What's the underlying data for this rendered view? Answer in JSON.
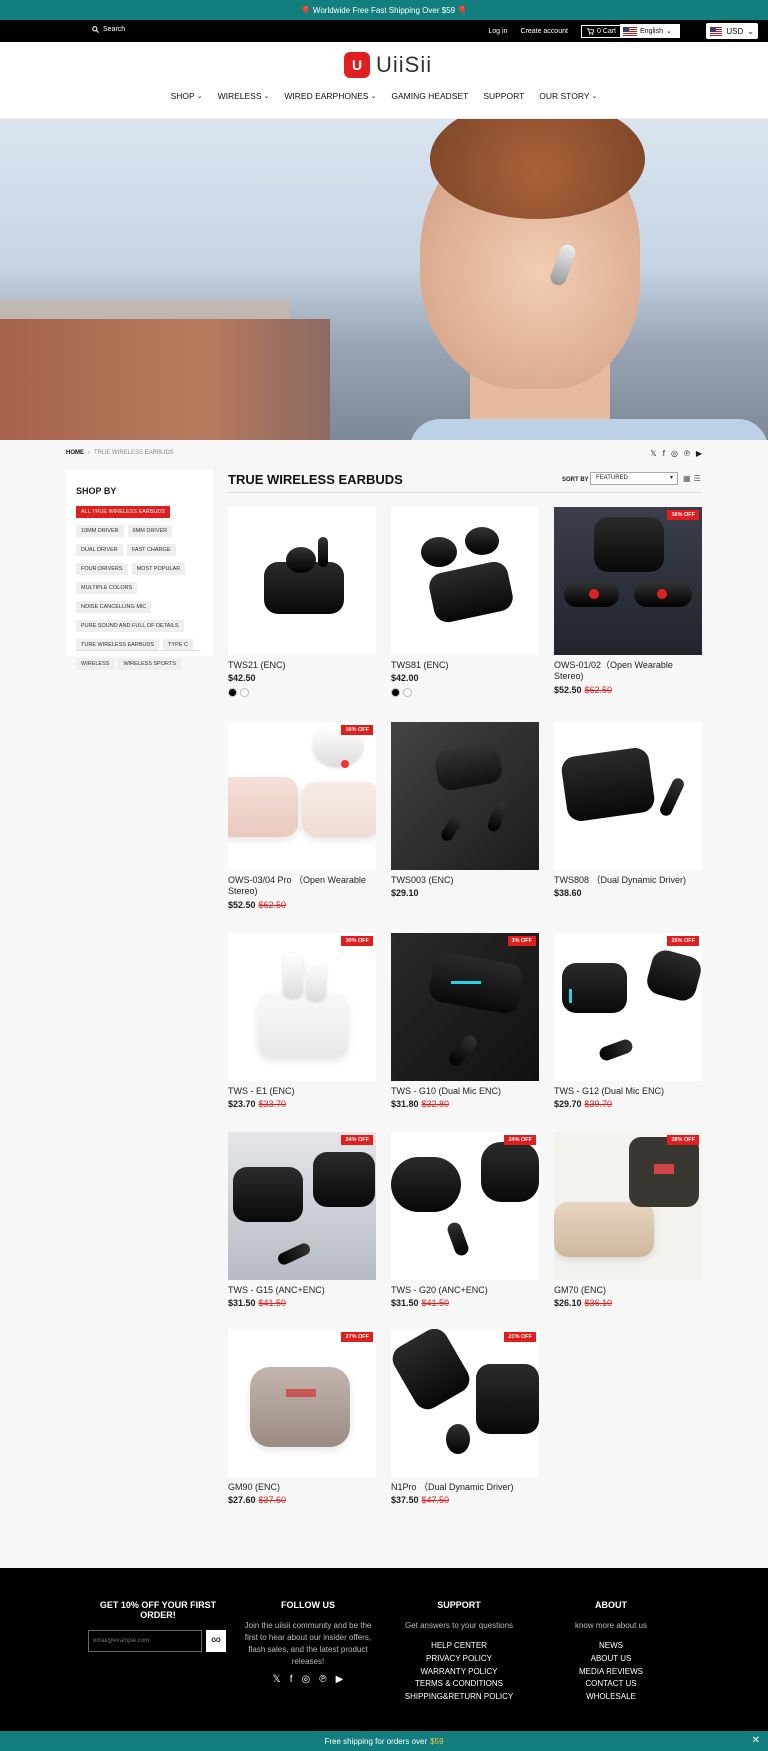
{
  "announce": {
    "text": "🎈 Worldwide Free Fast Shipping Over $59 🎈"
  },
  "topbar": {
    "search": "Search",
    "login": "Log in",
    "create_account": "Create account",
    "cart": "0 Cart",
    "language": "English",
    "currency": "USD"
  },
  "logo": {
    "mark": "U",
    "word": "UiiSii"
  },
  "nav": [
    "SHOP",
    "WIRELESS",
    "WIRED EARPHONES",
    "GAMING HEADSET",
    "SUPPORT",
    "OUR STORY"
  ],
  "nav_dropdown": [
    true,
    true,
    true,
    false,
    false,
    true
  ],
  "breadcrumb": {
    "home": "HOME",
    "sep": "›",
    "current": "TRUE WIRELESS EARBUDS"
  },
  "sidebar": {
    "title": "SHOP BY",
    "tags": [
      "ALL TRUE WIRELESS EARBUDS",
      "10MM DRIVER",
      "6MM DRIVER",
      "DUAL DRIVER",
      "FAST CHARGE",
      "FOUR DRIVERS",
      "MOST POPULAR",
      "MULTIPLE COLORS",
      "NOISE CANCELLING MIC",
      "PURE SOUND AND FULL OF DETAILS",
      "TURE WIRELESS EARBUDS",
      "TYPE C",
      "WIRELESS",
      "WIRELESS SPORTS"
    ]
  },
  "collection": {
    "title": "TRUE WIRELESS EARBUDS",
    "sort_label": "SORT BY",
    "sort_value": "FEATURED"
  },
  "products": [
    {
      "name": "TWS21 (ENC)",
      "price": "$42.50",
      "was": "",
      "badge": "",
      "swatches": true
    },
    {
      "name": "TWS81 (ENC)",
      "price": "$42.00",
      "was": "",
      "badge": "",
      "swatches": true
    },
    {
      "name": "OWS-01/02（Open Wearable Stereo)",
      "price": "$52.50",
      "was": "$62.50",
      "badge": "16% OFF"
    },
    {
      "name": "OWS-03/04 Pro （Open Wearable Stereo)",
      "price": "$52.50",
      "was": "$62.50",
      "badge": "16% OFF"
    },
    {
      "name": "TWS003 (ENC)",
      "price": "$29.10",
      "was": "",
      "badge": ""
    },
    {
      "name": "TWS808 （Dual Dynamic Driver)",
      "price": "$38.60",
      "was": "",
      "badge": ""
    },
    {
      "name": "TWS - E1 (ENC)",
      "price": "$23.70",
      "was": "$33.70",
      "badge": "30% OFF"
    },
    {
      "name": "TWS - G10 (Dual Mic ENC)",
      "price": "$31.80",
      "was": "$32.80",
      "badge": "3% OFF"
    },
    {
      "name": "TWS - G12 (Dual Mic ENC)",
      "price": "$29.70",
      "was": "$39.70",
      "badge": "25% OFF"
    },
    {
      "name": "TWS - G15 (ANC+ENC)",
      "price": "$31.50",
      "was": "$41.50",
      "badge": "24% OFF"
    },
    {
      "name": "TWS - G20 (ANC+ENC)",
      "price": "$31.50",
      "was": "$41.50",
      "badge": "24% OFF"
    },
    {
      "name": "GM70 (ENC)",
      "price": "$26.10",
      "was": "$36.10",
      "badge": "28% OFF"
    },
    {
      "name": "GM90 (ENC)",
      "price": "$27.60",
      "was": "$37.60",
      "badge": "27% OFF"
    },
    {
      "name": "N1Pro （Dual Dynamic Driver)",
      "price": "$37.50",
      "was": "$47.50",
      "badge": "21% OFF"
    }
  ],
  "footer": {
    "newsletter": {
      "title": "GET 10% OFF YOUR FIRST ORDER!",
      "placeholder": "email@example.com",
      "button": "GO"
    },
    "follow": {
      "title": "FOLLOW US",
      "text": "Join the uiisii community and be the first to hear about our insider offers, flash sales, and the latest product releases!"
    },
    "support": {
      "title": "SUPPORT",
      "subtitle": "Get answers to your questions",
      "links": [
        "HELP CENTER",
        "PRIVACY POLICY",
        "WARRANTY POLICY",
        "TERMS & CONDITIONS",
        "SHIPPING&RETURN POLICY"
      ]
    },
    "about": {
      "title": "ABOUT",
      "subtitle": "know more about us",
      "links": [
        "NEWS",
        "ABOUT US",
        "MEDIA REVIEWS",
        "CONTACT US",
        "WHOLESALE"
      ]
    }
  },
  "bottombar": {
    "text": "Free shipping for orders over",
    "amount": "$59",
    "close": "✕"
  },
  "colors": {
    "teal": "#137e7e",
    "sale_red": "#e21d1d",
    "brand_red": "#e02020"
  },
  "icons": [
    "search-icon",
    "cart-icon",
    "twitter-icon",
    "facebook-icon",
    "instagram-icon",
    "pinterest-icon",
    "youtube-icon",
    "grid-view-icon",
    "list-view-icon",
    "close-icon"
  ]
}
